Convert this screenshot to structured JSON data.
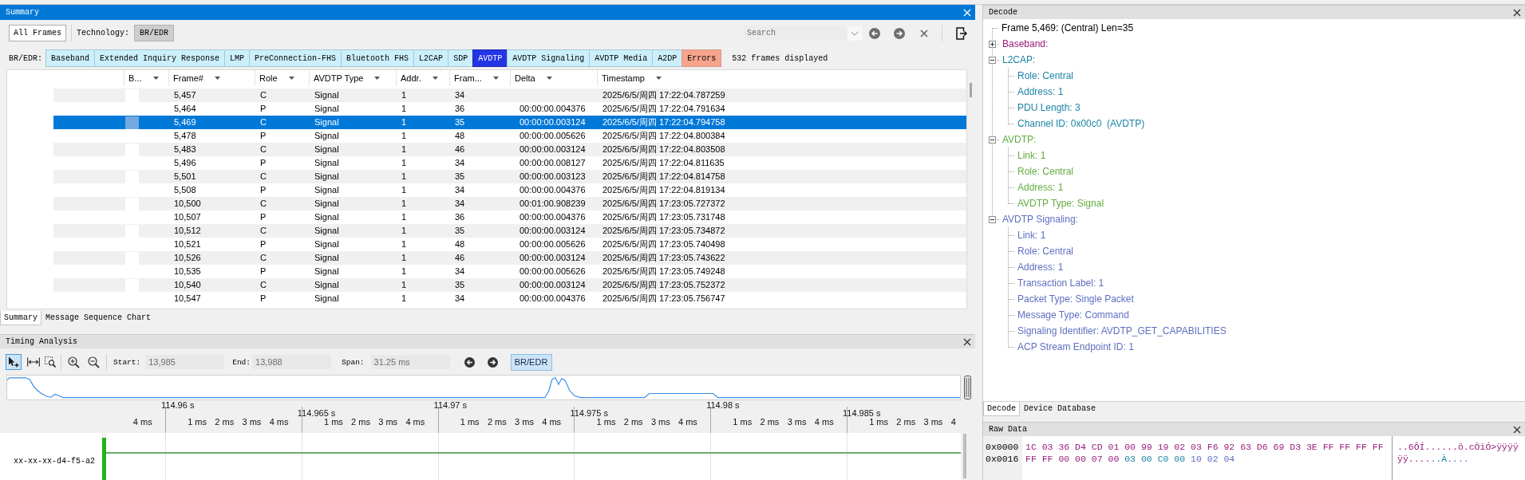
{
  "summary": {
    "title": "Summary",
    "all_frames": "All Frames",
    "technology_label": "Technology:",
    "technology_button": {
      "label": "BR/EDR",
      "selected": true
    },
    "search": {
      "placeholder": "Search"
    },
    "filter": {
      "label": "BR/EDR:",
      "tabs": [
        {
          "label": "Baseband",
          "kind": "protocol",
          "selected": false
        },
        {
          "label": "Extended Inquiry Response",
          "kind": "protocol",
          "selected": false
        },
        {
          "label": "LMP",
          "kind": "protocol",
          "selected": false
        },
        {
          "label": "PreConnection-FHS",
          "kind": "protocol",
          "selected": false
        },
        {
          "label": "Bluetooth FHS",
          "kind": "protocol",
          "selected": false
        },
        {
          "label": "L2CAP",
          "kind": "protocol",
          "selected": false
        },
        {
          "label": "SDP",
          "kind": "protocol",
          "selected": false
        },
        {
          "label": "AVDTP",
          "kind": "protocol",
          "selected": true
        },
        {
          "label": "AVDTP Signaling",
          "kind": "protocol",
          "selected": false
        },
        {
          "label": "AVDTP Media",
          "kind": "protocol",
          "selected": false
        },
        {
          "label": "A2DP",
          "kind": "protocol",
          "selected": false
        },
        {
          "label": "Errors",
          "kind": "errors",
          "selected": false
        }
      ],
      "count": "532 frames displayed"
    },
    "table": {
      "columns": [
        "B...",
        "Frame#",
        "Role",
        "AVDTP Type",
        "Addr.",
        "Fram...",
        "Delta",
        "Timestamp"
      ],
      "rows": [
        {
          "frame": "5,457",
          "role": "C",
          "avdtp_type": "Signal",
          "addr": "1",
          "column_6": "34",
          "timestamp": "2025/6/5/周四 17:22:04.787259",
          "selected": false
        },
        {
          "frame": "5,464",
          "role": "P",
          "avdtp_type": "Signal",
          "addr": "1",
          "column_6": "36",
          "delta": "00:00:00.004376",
          "timestamp": "2025/6/5/周四 17:22:04.791634",
          "selected": false
        },
        {
          "frame": "5,469",
          "role": "C",
          "avdtp_type": "Signal",
          "addr": "1",
          "column_6": "35",
          "delta": "00:00:00.003124",
          "timestamp": "2025/6/5/周四 17:22:04.794758",
          "selected": true
        },
        {
          "frame": "5,478",
          "role": "P",
          "avdtp_type": "Signal",
          "addr": "1",
          "column_6": "48",
          "delta": "00:00:00.005626",
          "timestamp": "2025/6/5/周四 17:22:04.800384",
          "selected": false
        },
        {
          "frame": "5,483",
          "role": "C",
          "avdtp_type": "Signal",
          "addr": "1",
          "column_6": "46",
          "delta": "00:00:00.003124",
          "timestamp": "2025/6/5/周四 17:22:04.803508",
          "selected": false
        },
        {
          "frame": "5,496",
          "role": "P",
          "avdtp_type": "Signal",
          "addr": "1",
          "column_6": "34",
          "delta": "00:00:00.008127",
          "timestamp": "2025/6/5/周四 17:22:04.811635",
          "selected": false
        },
        {
          "frame": "5,501",
          "role": "C",
          "avdtp_type": "Signal",
          "addr": "1",
          "column_6": "35",
          "delta": "00:00:00.003123",
          "timestamp": "2025/6/5/周四 17:22:04.814758",
          "selected": false
        },
        {
          "frame": "5,508",
          "role": "P",
          "avdtp_type": "Signal",
          "addr": "1",
          "column_6": "34",
          "delta": "00:00:00.004376",
          "timestamp": "2025/6/5/周四 17:22:04.819134",
          "selected": false
        },
        {
          "frame": "10,500",
          "role": "C",
          "avdtp_type": "Signal",
          "addr": "1",
          "column_6": "34",
          "delta": "00:01:00.908239",
          "timestamp": "2025/6/5/周四 17:23:05.727372",
          "selected": false
        },
        {
          "frame": "10,507",
          "role": "P",
          "avdtp_type": "Signal",
          "addr": "1",
          "column_6": "36",
          "delta": "00:00:00.004376",
          "timestamp": "2025/6/5/周四 17:23:05.731748",
          "selected": false
        },
        {
          "frame": "10,512",
          "role": "C",
          "avdtp_type": "Signal",
          "addr": "1",
          "column_6": "35",
          "delta": "00:00:00.003124",
          "timestamp": "2025/6/5/周四 17:23:05.734872",
          "selected": false
        },
        {
          "frame": "10,521",
          "role": "P",
          "avdtp_type": "Signal",
          "addr": "1",
          "column_6": "48",
          "delta": "00:00:00.005626",
          "timestamp": "2025/6/5/周四 17:23:05.740498",
          "selected": false
        },
        {
          "frame": "10,526",
          "role": "C",
          "avdtp_type": "Signal",
          "addr": "1",
          "column_6": "46",
          "delta": "00:00:00.003124",
          "timestamp": "2025/6/5/周四 17:23:05.743622",
          "selected": false
        },
        {
          "frame": "10,535",
          "role": "P",
          "avdtp_type": "Signal",
          "addr": "1",
          "column_6": "34",
          "delta": "00:00:00.005626",
          "timestamp": "2025/6/5/周四 17:23:05.749248",
          "selected": false
        },
        {
          "frame": "10,540",
          "role": "C",
          "avdtp_type": "Signal",
          "addr": "1",
          "column_6": "35",
          "delta": "00:00:00.003124",
          "timestamp": "2025/6/5/周四 17:23:05.752372",
          "selected": false
        },
        {
          "frame": "10,547",
          "role": "P",
          "avdtp_type": "Signal",
          "addr": "1",
          "column_6": "34",
          "delta": "00:00:00.004376",
          "timestamp": "2025/6/5/周四 17:23:05.756747",
          "selected": false
        }
      ]
    },
    "tabs": [
      {
        "label": "Summary",
        "selected": true
      },
      {
        "label": "Message Sequence Chart",
        "selected": false
      }
    ]
  },
  "timing": {
    "title": "Timing Analysis",
    "tools": [
      {
        "selected": true
      },
      {
        "selected": false
      },
      {
        "selected": false
      }
    ],
    "start": {
      "label": "Start:",
      "value": "13,985"
    },
    "end": {
      "label": "End:",
      "value": "13,988"
    },
    "span": {
      "label": "Span:",
      "value": "31.25 ms"
    },
    "technology_button": {
      "label": "BR/EDR",
      "selected": true
    },
    "ruler": {
      "lead_ticks": [
        "4 ms"
      ],
      "segments": [
        {
          "label": "114.96 s",
          "ticks": [
            "1 ms",
            "2 ms",
            "3 ms",
            "4 ms"
          ]
        },
        {
          "label": "114.965 s",
          "ticks": [
            "1 ms",
            "2 ms",
            "3 ms",
            "4 ms"
          ]
        },
        {
          "label": "114.97 s",
          "ticks": [
            "1 ms",
            "2 ms",
            "3 ms",
            "4 ms"
          ]
        },
        {
          "label": "114.975 s",
          "ticks": [
            "1 ms",
            "2 ms",
            "3 ms",
            "4 ms"
          ]
        },
        {
          "label": "114.98 s",
          "ticks": [
            "1 ms",
            "2 ms",
            "3 ms",
            "4 ms"
          ]
        },
        {
          "label": "114.985 s",
          "ticks": [
            "1 ms",
            "2 ms",
            "3 ms",
            "4"
          ]
        }
      ]
    },
    "devices": [
      {
        "name": "xx-xx-xx-d4-f5-a2"
      }
    ]
  },
  "decode": {
    "title": "Decode",
    "frame": "Frame 5,469: (Central) Len=35",
    "tree": [
      {
        "label": "Baseband:",
        "color": "#9a1b7b",
        "expanded": false
      },
      {
        "label": "L2CAP:",
        "color": "#1b85a6",
        "expanded": true,
        "children": [
          {
            "label": "Role: Central"
          },
          {
            "label": "Address: 1"
          },
          {
            "label": "PDU Length: 3"
          },
          {
            "label": "Channel ID: 0x00c0  (AVDTP)"
          }
        ]
      },
      {
        "label": "AVDTP:",
        "color": "#63ad43",
        "expanded": true,
        "children": [
          {
            "label": "Link: 1"
          },
          {
            "label": "Role: Central"
          },
          {
            "label": "Address: 1"
          },
          {
            "label": "AVDTP Type: Signal"
          }
        ]
      },
      {
        "label": "AVDTP Signaling:",
        "color": "#5f6fc0",
        "expanded": true,
        "children": [
          {
            "label": "Link: 1"
          },
          {
            "label": "Role: Central"
          },
          {
            "label": "Address: 1"
          },
          {
            "label": "Transaction Label: 1"
          },
          {
            "label": "Packet Type: Single Packet"
          },
          {
            "label": "Message Type: Command"
          },
          {
            "label": "Signaling Identifier: AVDTP_GET_CAPABILITIES"
          },
          {
            "label": "ACP Stream Endpoint ID: 1"
          }
        ]
      }
    ],
    "tabs": [
      {
        "label": "Decode",
        "selected": true
      },
      {
        "label": "Device Database",
        "selected": false
      }
    ]
  },
  "raw_data": {
    "title": "Raw Data",
    "rows": [
      {
        "offset": "0x0000",
        "segments": [
          {
            "hex": "1C 03 36 D4 CD 01 00 99 19 02 03 F6 92 63 D6 69 D3 3E FF FF FF FF",
            "ascii": "..6ÔÍ......ö.cÖiÓ>ÿÿÿÿ",
            "color": "#9a1b7b"
          }
        ]
      },
      {
        "offset": "0x0016",
        "segments": [
          {
            "hex": "FF FF 00 00 07 00",
            "ascii": "ÿÿ....",
            "color": "#9a1b7b"
          },
          {
            "hex": "03 00 C0 00",
            "ascii": "..À.",
            "color": "#1b85a6"
          },
          {
            "hex": "10 02 04",
            "ascii": "...",
            "color": "#5f6fc0"
          }
        ]
      }
    ]
  }
}
